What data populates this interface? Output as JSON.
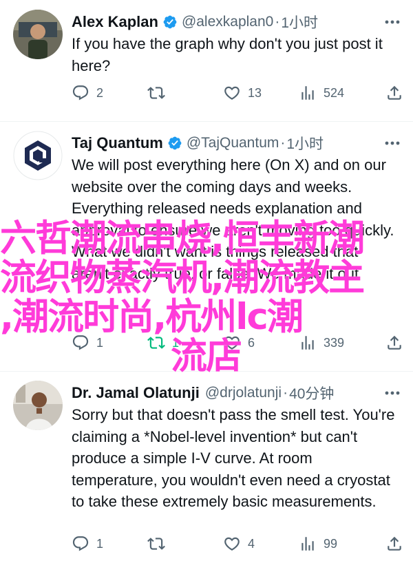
{
  "tweets": [
    {
      "name": "Alex Kaplan",
      "handle": "@alexkaplan0",
      "time": "1小时",
      "text": "If you have the graph why don't you just post it here?",
      "replies": "2",
      "retweets": "",
      "likes": "13",
      "views": "524"
    },
    {
      "name": "Taj Quantum",
      "handle": "@TajQuantum",
      "time": "1小时",
      "text": "We will post everything here (On X) and on our website over the coming days and weeks. Everything released needs explanation and approval to ensure we aren't moving too quickly. What we didn't want is things released that aren't exactly true, or false. We made it out",
      "replies": "1",
      "retweets": "1",
      "likes": "6",
      "views": "339"
    },
    {
      "name": "Dr. Jamal Olatunji",
      "handle": "@drjolatunji",
      "time": "40分钟",
      "text": "Sorry but that doesn't pass the smell test. You're claiming a *Nobel-level invention* but can't produce a simple I-V curve. At room temperature, you wouldn't even need a cryostat to take these extremely basic measurements.",
      "replies": "1",
      "retweets": "",
      "likes": "4",
      "views": "99"
    }
  ],
  "overlay": {
    "line1": "六哲潮流串烧,恒丰新潮",
    "line2": "流织物蒸汽机,潮流教主",
    "line3": ",潮流时尚,杭州lc潮",
    "line4": "流店"
  },
  "icons": {
    "reply": "reply-icon",
    "retweet": "retweet-icon",
    "like": "heart-icon",
    "views": "views-icon",
    "share": "share-icon",
    "more": "more-icon",
    "verified": "verified-badge-icon"
  },
  "colors": {
    "text": "#0f1419",
    "secondary": "#536471",
    "verified": "#1d9bf0",
    "retweeted": "#00ba7c",
    "overlay": "#ff3bd9"
  }
}
